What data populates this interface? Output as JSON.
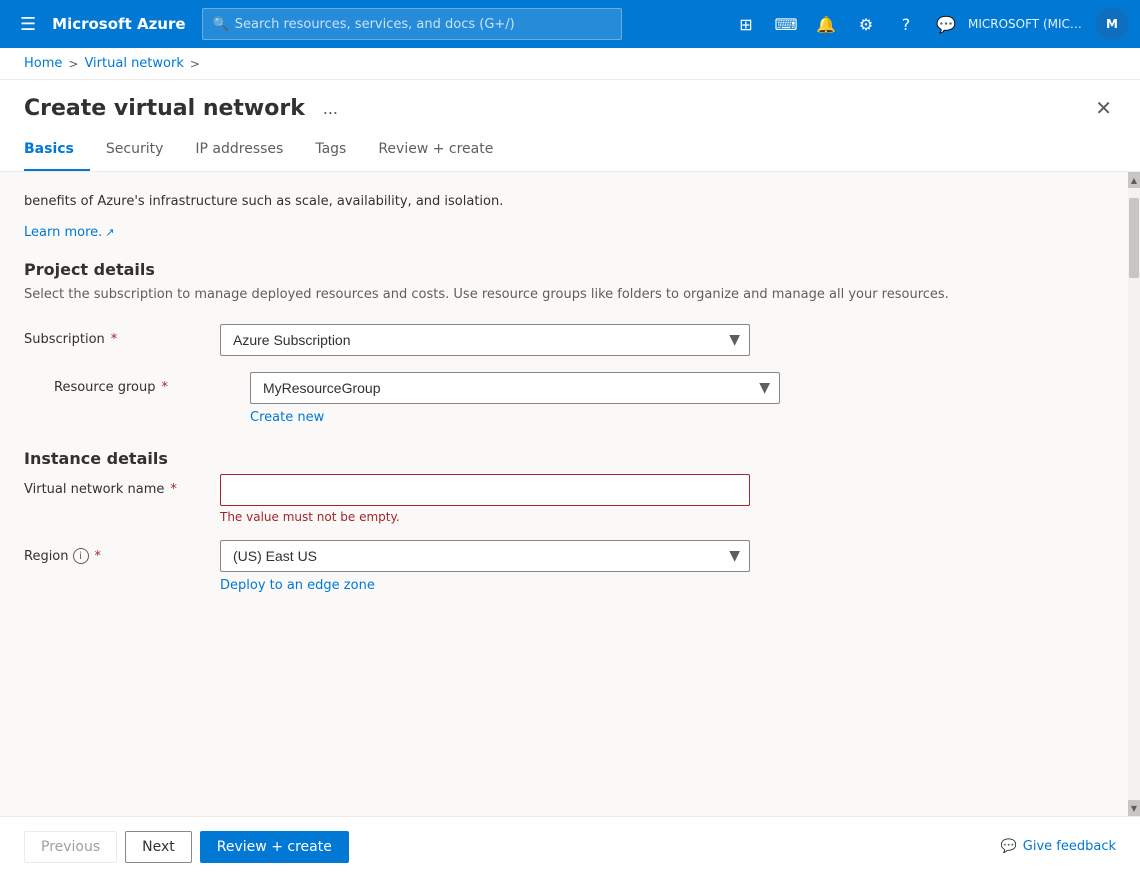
{
  "topbar": {
    "hamburger": "☰",
    "logo": "Microsoft Azure",
    "search_placeholder": "Search resources, services, and docs (G+/)",
    "username": "MICROSOFT (MICROSOFT.ONMI...",
    "icons": [
      "portal",
      "cloud-shell",
      "notifications",
      "settings",
      "help",
      "feedback"
    ]
  },
  "breadcrumb": {
    "home": "Home",
    "virtual_network": "Virtual network",
    "sep1": ">",
    "sep2": ">"
  },
  "page": {
    "title": "Create virtual network",
    "more_label": "...",
    "close_label": "✕"
  },
  "tabs": [
    {
      "label": "Basics",
      "active": true
    },
    {
      "label": "Security",
      "active": false
    },
    {
      "label": "IP addresses",
      "active": false
    },
    {
      "label": "Tags",
      "active": false
    },
    {
      "label": "Review + create",
      "active": false
    }
  ],
  "content": {
    "description": "benefits of Azure's infrastructure such as scale, availability, and isolation.",
    "learn_more": "Learn more.",
    "sections": {
      "project": {
        "title": "Project details",
        "description": "Select the subscription to manage deployed resources and costs. Use resource groups like folders to organize and manage all your resources."
      },
      "instance": {
        "title": "Instance details"
      }
    },
    "form": {
      "subscription_label": "Subscription",
      "subscription_value": "Azure Subscription",
      "resource_group_label": "Resource group",
      "resource_group_value": "MyResourceGroup",
      "create_new": "Create new",
      "vnet_name_label": "Virtual network name",
      "vnet_name_value": "",
      "vnet_name_placeholder": "",
      "error_msg": "The value must not be empty.",
      "region_label": "Region",
      "region_value": "(US) East US",
      "deploy_link": "Deploy to an edge zone",
      "required_indicator": "*"
    }
  },
  "footer": {
    "previous_label": "Previous",
    "next_label": "Next",
    "review_create_label": "Review + create",
    "feedback_label": "Give feedback"
  }
}
